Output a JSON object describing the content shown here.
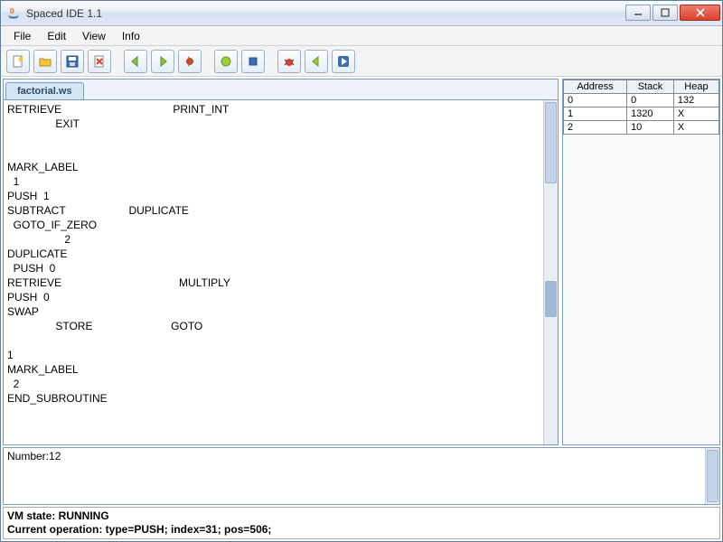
{
  "window": {
    "title": "Spaced IDE 1.1"
  },
  "menu": {
    "items": [
      "File",
      "Edit",
      "View",
      "Info"
    ]
  },
  "toolbar": {
    "groups": [
      [
        "new-file",
        "open-file",
        "save-file",
        "close-file"
      ],
      [
        "step-back",
        "step-forward",
        "debug-stop"
      ],
      [
        "run",
        "stop"
      ],
      [
        "bug",
        "step-into",
        "continue"
      ]
    ]
  },
  "tabs": [
    {
      "label": "factorial.ws"
    }
  ],
  "editor": {
    "text": "RETRIEVE                                     PRINT_INT\n                EXIT\n\n\nMARK_LABEL\n  1\nPUSH  1\nSUBTRACT                     DUPLICATE\n  GOTO_IF_ZERO\n                   2\nDUPLICATE\n  PUSH  0\nRETRIEVE                                       MULTIPLY\nPUSH  0\nSWAP\n                STORE                          GOTO\n\n1\nMARK_LABEL\n  2\nEND_SUBROUTINE"
  },
  "memory": {
    "headers": [
      "Address",
      "Stack",
      "Heap"
    ],
    "rows": [
      {
        "address": "0",
        "stack": "0",
        "heap": "132"
      },
      {
        "address": "1",
        "stack": "1320",
        "heap": "X"
      },
      {
        "address": "2",
        "stack": "10",
        "heap": "X"
      }
    ]
  },
  "console": {
    "text": "Number:12"
  },
  "status": {
    "vm_state": "VM state: RUNNING",
    "operation": "Current operation: type=PUSH; index=31; pos=506;"
  }
}
